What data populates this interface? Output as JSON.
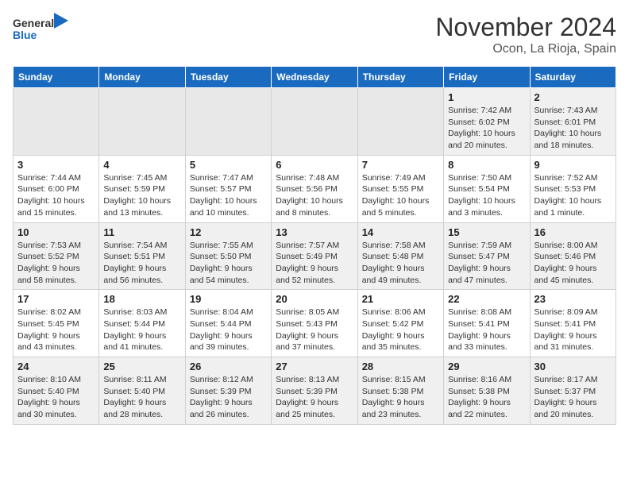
{
  "header": {
    "logo_line1": "General",
    "logo_line2": "Blue",
    "month": "November 2024",
    "location": "Ocon, La Rioja, Spain"
  },
  "days_of_week": [
    "Sunday",
    "Monday",
    "Tuesday",
    "Wednesday",
    "Thursday",
    "Friday",
    "Saturday"
  ],
  "weeks": [
    [
      {
        "day": "",
        "info": ""
      },
      {
        "day": "",
        "info": ""
      },
      {
        "day": "",
        "info": ""
      },
      {
        "day": "",
        "info": ""
      },
      {
        "day": "",
        "info": ""
      },
      {
        "day": "1",
        "info": "Sunrise: 7:42 AM\nSunset: 6:02 PM\nDaylight: 10 hours\nand 20 minutes."
      },
      {
        "day": "2",
        "info": "Sunrise: 7:43 AM\nSunset: 6:01 PM\nDaylight: 10 hours\nand 18 minutes."
      }
    ],
    [
      {
        "day": "3",
        "info": "Sunrise: 7:44 AM\nSunset: 6:00 PM\nDaylight: 10 hours\nand 15 minutes."
      },
      {
        "day": "4",
        "info": "Sunrise: 7:45 AM\nSunset: 5:59 PM\nDaylight: 10 hours\nand 13 minutes."
      },
      {
        "day": "5",
        "info": "Sunrise: 7:47 AM\nSunset: 5:57 PM\nDaylight: 10 hours\nand 10 minutes."
      },
      {
        "day": "6",
        "info": "Sunrise: 7:48 AM\nSunset: 5:56 PM\nDaylight: 10 hours\nand 8 minutes."
      },
      {
        "day": "7",
        "info": "Sunrise: 7:49 AM\nSunset: 5:55 PM\nDaylight: 10 hours\nand 5 minutes."
      },
      {
        "day": "8",
        "info": "Sunrise: 7:50 AM\nSunset: 5:54 PM\nDaylight: 10 hours\nand 3 minutes."
      },
      {
        "day": "9",
        "info": "Sunrise: 7:52 AM\nSunset: 5:53 PM\nDaylight: 10 hours\nand 1 minute."
      }
    ],
    [
      {
        "day": "10",
        "info": "Sunrise: 7:53 AM\nSunset: 5:52 PM\nDaylight: 9 hours\nand 58 minutes."
      },
      {
        "day": "11",
        "info": "Sunrise: 7:54 AM\nSunset: 5:51 PM\nDaylight: 9 hours\nand 56 minutes."
      },
      {
        "day": "12",
        "info": "Sunrise: 7:55 AM\nSunset: 5:50 PM\nDaylight: 9 hours\nand 54 minutes."
      },
      {
        "day": "13",
        "info": "Sunrise: 7:57 AM\nSunset: 5:49 PM\nDaylight: 9 hours\nand 52 minutes."
      },
      {
        "day": "14",
        "info": "Sunrise: 7:58 AM\nSunset: 5:48 PM\nDaylight: 9 hours\nand 49 minutes."
      },
      {
        "day": "15",
        "info": "Sunrise: 7:59 AM\nSunset: 5:47 PM\nDaylight: 9 hours\nand 47 minutes."
      },
      {
        "day": "16",
        "info": "Sunrise: 8:00 AM\nSunset: 5:46 PM\nDaylight: 9 hours\nand 45 minutes."
      }
    ],
    [
      {
        "day": "17",
        "info": "Sunrise: 8:02 AM\nSunset: 5:45 PM\nDaylight: 9 hours\nand 43 minutes."
      },
      {
        "day": "18",
        "info": "Sunrise: 8:03 AM\nSunset: 5:44 PM\nDaylight: 9 hours\nand 41 minutes."
      },
      {
        "day": "19",
        "info": "Sunrise: 8:04 AM\nSunset: 5:44 PM\nDaylight: 9 hours\nand 39 minutes."
      },
      {
        "day": "20",
        "info": "Sunrise: 8:05 AM\nSunset: 5:43 PM\nDaylight: 9 hours\nand 37 minutes."
      },
      {
        "day": "21",
        "info": "Sunrise: 8:06 AM\nSunset: 5:42 PM\nDaylight: 9 hours\nand 35 minutes."
      },
      {
        "day": "22",
        "info": "Sunrise: 8:08 AM\nSunset: 5:41 PM\nDaylight: 9 hours\nand 33 minutes."
      },
      {
        "day": "23",
        "info": "Sunrise: 8:09 AM\nSunset: 5:41 PM\nDaylight: 9 hours\nand 31 minutes."
      }
    ],
    [
      {
        "day": "24",
        "info": "Sunrise: 8:10 AM\nSunset: 5:40 PM\nDaylight: 9 hours\nand 30 minutes."
      },
      {
        "day": "25",
        "info": "Sunrise: 8:11 AM\nSunset: 5:40 PM\nDaylight: 9 hours\nand 28 minutes."
      },
      {
        "day": "26",
        "info": "Sunrise: 8:12 AM\nSunset: 5:39 PM\nDaylight: 9 hours\nand 26 minutes."
      },
      {
        "day": "27",
        "info": "Sunrise: 8:13 AM\nSunset: 5:39 PM\nDaylight: 9 hours\nand 25 minutes."
      },
      {
        "day": "28",
        "info": "Sunrise: 8:15 AM\nSunset: 5:38 PM\nDaylight: 9 hours\nand 23 minutes."
      },
      {
        "day": "29",
        "info": "Sunrise: 8:16 AM\nSunset: 5:38 PM\nDaylight: 9 hours\nand 22 minutes."
      },
      {
        "day": "30",
        "info": "Sunrise: 8:17 AM\nSunset: 5:37 PM\nDaylight: 9 hours\nand 20 minutes."
      }
    ]
  ]
}
